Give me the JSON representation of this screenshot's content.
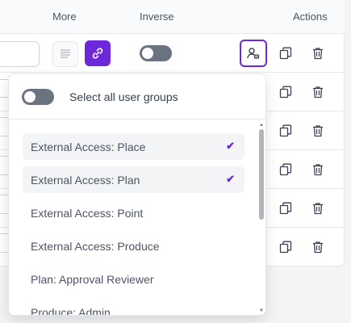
{
  "table": {
    "headers": {
      "more": "More",
      "inverse": "Inverse",
      "actions": "Actions"
    },
    "first_row": {
      "inverse_enabled": false
    }
  },
  "dropdown": {
    "select_all_label": "Select all user groups",
    "select_all_enabled": false,
    "options": [
      {
        "label": "External Access: Place",
        "selected": true
      },
      {
        "label": "External Access: Plan",
        "selected": true
      },
      {
        "label": "External Access: Point",
        "selected": false
      },
      {
        "label": "External Access: Produce",
        "selected": false
      },
      {
        "label": "Plan: Approval Reviewer",
        "selected": false
      },
      {
        "label": "Produce: Admin",
        "selected": false
      }
    ],
    "check_glyph": "✔"
  },
  "colors": {
    "accent": "#6d28d9",
    "toggle_off": "#6b7280",
    "selected_bg": "#f3f4f6"
  }
}
